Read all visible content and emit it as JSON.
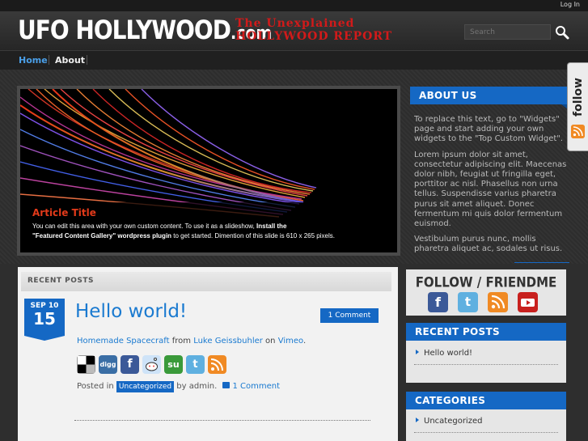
{
  "topbar": {
    "login": "Log In"
  },
  "header": {
    "logo_main": "UFO HOLLYWOOD",
    "logo_domain": ".com",
    "tagline_line1": "The Unexplained",
    "tagline_line2": "HOLLYWOOD REPORT",
    "search_placeholder": "Search"
  },
  "nav": {
    "items": [
      {
        "label": "Home"
      },
      {
        "label": "About"
      }
    ]
  },
  "slideshow": {
    "title": "Article Title",
    "text_before": "You can edit this area with your own custom content. To use it as a slideshow, ",
    "text_bold1": "Install the",
    "text_bold2": "\"Featured Content Gallery\" wordpress plugin",
    "text_after": " to get started. Dimention of this slide is 610 x 265 pixels."
  },
  "about": {
    "heading": "ABOUT US",
    "p1": "To replace this text, go to \"Widgets\" page and start adding your own widgets to the \"Top Custom Widget\".",
    "p2": "Lorem ipsum dolor sit amet, consectetur adipiscing elit. Maecenas dolor nibh, feugiat ut fringilla eget, porttitor ac nisl. Phasellus non urna tellus. Suspendisse varius pharetra purus sit amet aliquet. Donec fermentum mi quis dolor fermentum euismod.",
    "p3": "Vestibulum purus nunc, mollis pharetra aliquet ac, sodales ut risus."
  },
  "follow_tab": {
    "label": "follow"
  },
  "recent_posts_label": "RECENT POSTS",
  "post": {
    "month": "SEP 10",
    "day": "15",
    "title": "Hello world!",
    "comment_button": "1 Comment",
    "link1": "Homemade Spacecraft",
    "from": " from ",
    "link2": "Luke Geissbuhler",
    "on": " on ",
    "link3": "Vimeo",
    "period": ".",
    "posted_in": "Posted in ",
    "category": "Uncategorized",
    "by": " by admin. ",
    "comments": "1 Comment",
    "share_icons": [
      "delicious-icon",
      "digg-icon",
      "facebook-icon",
      "reddit-icon",
      "stumbleupon-icon",
      "twitter-icon",
      "rss-icon"
    ]
  },
  "sidebar": {
    "follow_title": "FOLLOW / FRIENDME",
    "social_icons": [
      "facebook-icon",
      "twitter-icon",
      "rss-icon",
      "youtube-icon"
    ],
    "recent_heading": "RECENT POSTS",
    "recent_items": [
      {
        "label": "Hello world!"
      }
    ],
    "categories_heading": "CATEGORIES",
    "category_items": [
      {
        "label": "Uncategorized"
      }
    ]
  },
  "colors": {
    "accent": "#1568c4",
    "link": "#1a7ad0",
    "tagline": "#d21a1a",
    "slide_title": "#e23a1a"
  }
}
